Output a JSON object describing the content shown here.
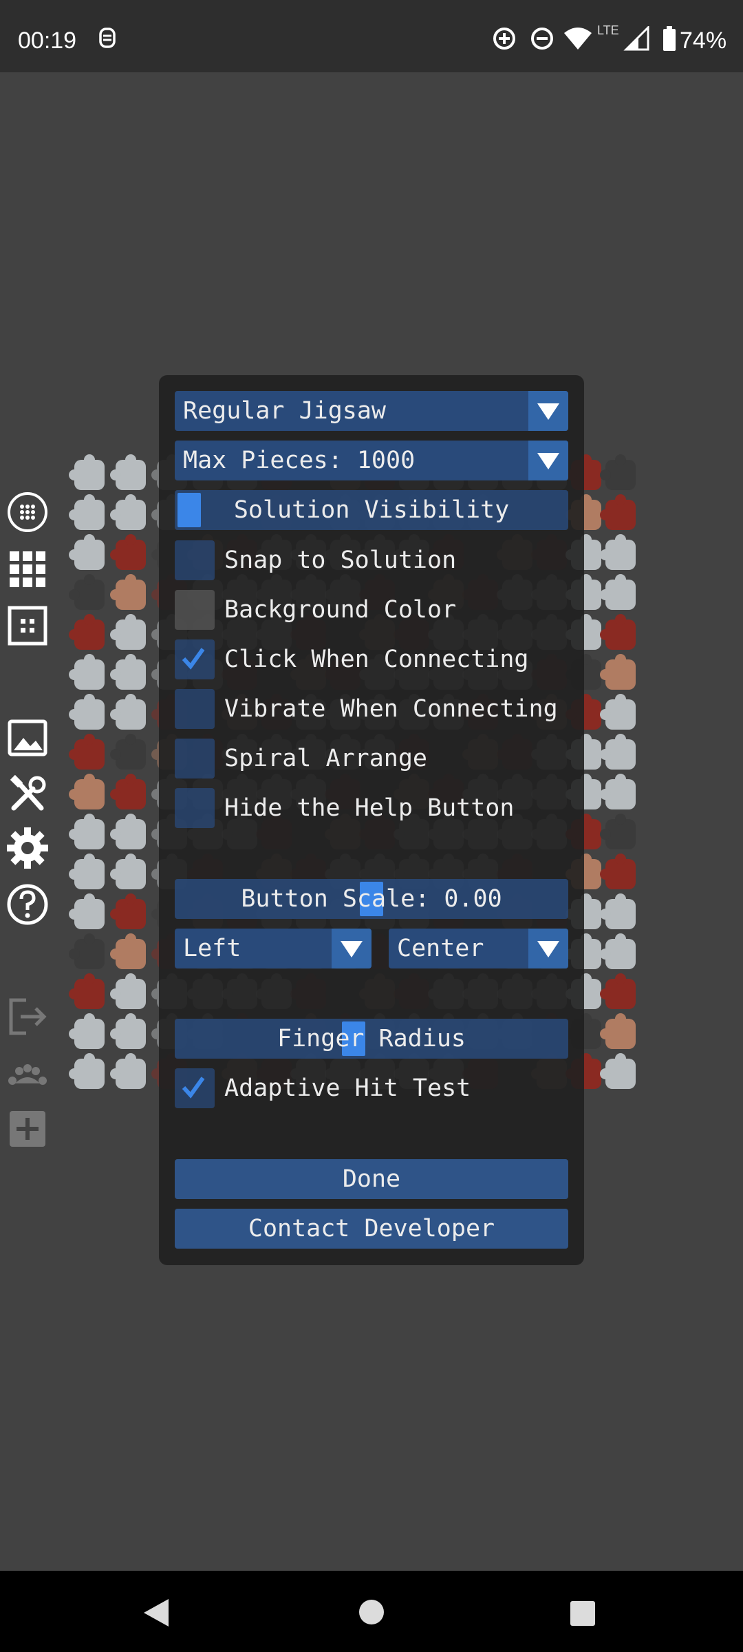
{
  "status_bar": {
    "time": "00:19",
    "network": "LTE",
    "battery": "74%",
    "icons": [
      "profile-icon",
      "add-circle-icon",
      "dnd-icon",
      "wifi-icon",
      "signal-icon",
      "battery-icon"
    ]
  },
  "toolbar": {
    "icons": [
      "scatter-icon",
      "grid-icon",
      "border-icon",
      "image-icon",
      "tools-icon",
      "settings-icon",
      "help-icon",
      "exit-icon",
      "palette-icon",
      "add-icon"
    ]
  },
  "dialog": {
    "puzzle_type": "Regular Jigsaw",
    "max_pieces": "Max Pieces: 1000",
    "solution_visibility": "Solution Visibility",
    "solution_visibility_value": 0.05,
    "options": [
      {
        "label": "Snap to Solution",
        "checked": false
      },
      {
        "label": "Background Color",
        "checked": false
      },
      {
        "label": "Click When Connecting",
        "checked": true
      },
      {
        "label": "Vibrate When Connecting",
        "checked": false
      },
      {
        "label": "Spiral Arrange",
        "checked": false
      },
      {
        "label": "Hide the Help Button",
        "checked": false
      }
    ],
    "button_scale": "Button Scale: 0.00",
    "button_scale_value": 0.5,
    "horizontal_align": "Left",
    "vertical_align": "Center",
    "finger_radius": "Finger Radius",
    "finger_radius_value": 0.45,
    "adaptive_hit_test": {
      "label": "Adaptive Hit Test",
      "checked": true
    },
    "done": "Done",
    "contact": "Contact Developer"
  },
  "colors": {
    "background": "#424242",
    "panel": "#202020",
    "widget": "#294a7a",
    "accent": "#3b86e8"
  }
}
